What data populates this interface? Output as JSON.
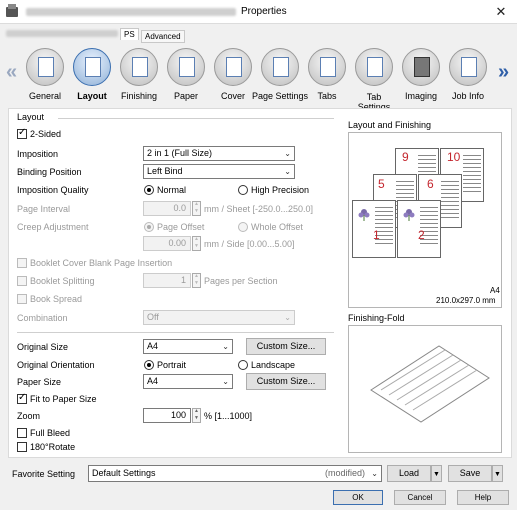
{
  "window": {
    "title": "Properties",
    "close_glyph": "✕"
  },
  "top_tabs": [
    {
      "label": "PS",
      "active": true
    },
    {
      "label": "Advanced",
      "active": false
    }
  ],
  "iconbar": {
    "items": [
      {
        "label": "General",
        "icon": "printer-icon",
        "active": false
      },
      {
        "label": "Layout",
        "icon": "layout-icon",
        "active": true
      },
      {
        "label": "Finishing",
        "icon": "finishing-icon",
        "active": false
      },
      {
        "label": "Paper",
        "icon": "paper-icon",
        "active": false
      },
      {
        "label": "Cover",
        "icon": "cover-icon",
        "active": false
      },
      {
        "label": "Page Settings",
        "icon": "page-settings-icon",
        "active": false
      },
      {
        "label": "Tabs",
        "icon": "tabs-icon",
        "active": false
      },
      {
        "label": "Tab Settings",
        "icon": "tab-settings-icon",
        "active": false
      },
      {
        "label": "Imaging",
        "icon": "imaging-icon",
        "active": false
      },
      {
        "label": "Job Info",
        "icon": "job-info-icon",
        "active": false
      }
    ],
    "left_arrow": "«",
    "right_arrow": "»"
  },
  "layout": {
    "group_title": "Layout",
    "two_sided": {
      "label": "2-Sided",
      "checked": true
    },
    "imposition": {
      "label": "Imposition",
      "value": "2 in 1 (Full Size)"
    },
    "binding_position": {
      "label": "Binding Position",
      "value": "Left Bind"
    },
    "imposition_quality": {
      "label": "Imposition Quality",
      "options": [
        "Normal",
        "High Precision"
      ],
      "selected": "Normal"
    },
    "page_interval": {
      "label": "Page Interval",
      "value": "0.0",
      "unit": "mm / Sheet [-250.0...250.0]"
    },
    "creep_adjustment": {
      "label": "Creep Adjustment",
      "options": [
        "Page Offset",
        "Whole Offset"
      ],
      "selected": "Page Offset",
      "value": "0.00",
      "unit": "mm / Side [0.00...5.00]"
    },
    "booklet_cover_blank": {
      "label": "Booklet Cover Blank Page Insertion",
      "checked": false
    },
    "booklet_splitting": {
      "label": "Booklet Splitting",
      "checked": false,
      "value": "1",
      "unit": "Pages per Section"
    },
    "book_spread": {
      "label": "Book Spread",
      "checked": false
    },
    "combination": {
      "label": "Combination",
      "value": "Off"
    }
  },
  "original": {
    "size": {
      "label": "Original Size",
      "value": "A4",
      "button": "Custom Size..."
    },
    "orientation": {
      "label": "Original Orientation",
      "options": [
        "Portrait",
        "Landscape"
      ],
      "selected": "Portrait"
    },
    "paper_size": {
      "label": "Paper Size",
      "value": "A4",
      "button": "Custom Size..."
    },
    "fit_to_paper": {
      "label": "Fit to Paper Size",
      "checked": true
    },
    "zoom": {
      "label": "Zoom",
      "value": "100",
      "unit": "% [1...1000]"
    },
    "full_bleed": {
      "label": "Full Bleed",
      "checked": false
    },
    "rotate_180": {
      "label": "180°Rotate",
      "checked": false
    }
  },
  "preview": {
    "layout_title": "Layout and Finishing",
    "paper_label": "A4",
    "paper_dims": "210.0x297.0 mm",
    "page_numbers": [
      "9",
      "10",
      "5",
      "6",
      "1",
      "2"
    ],
    "fold_title": "Finishing-Fold"
  },
  "favorite": {
    "label": "Favorite Setting",
    "value": "Default Settings",
    "status": "(modified)",
    "load": "Load",
    "save": "Save"
  },
  "dialog_buttons": {
    "ok": "OK",
    "cancel": "Cancel",
    "help": "Help"
  },
  "colors": {
    "accent": "#3b6fb0",
    "page_number": "#c4262e"
  }
}
